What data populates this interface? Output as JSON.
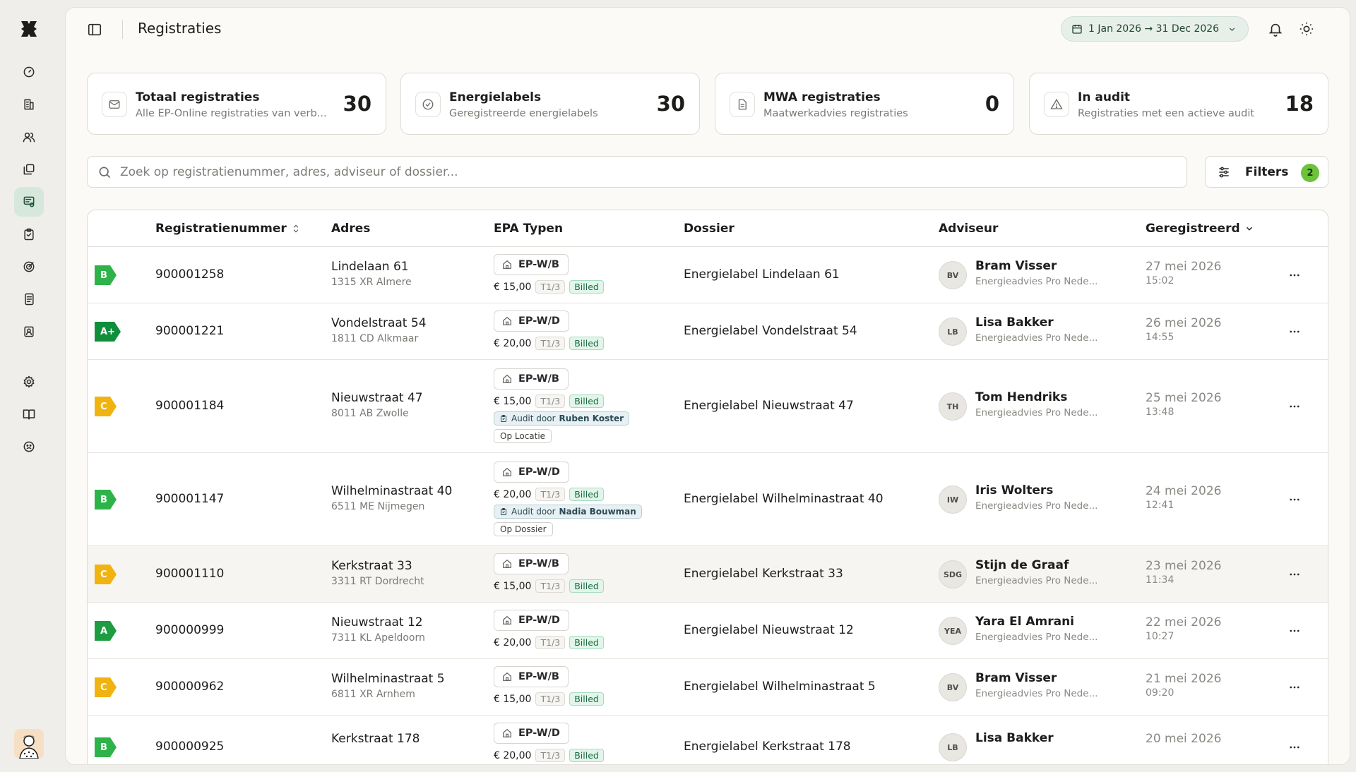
{
  "app": {
    "page_title": "Registraties"
  },
  "header": {
    "date_range": "1 Jan 2026 → 31 Dec 2026"
  },
  "nav": [
    "dashboard-icon",
    "buildings-icon",
    "users-icon",
    "files-icon",
    "registrations-icon",
    "clipboard-icon",
    "target-icon",
    "notebook-icon",
    "contacts-icon",
    "settings-icon",
    "book-icon",
    "smiley-icon"
  ],
  "cards": [
    {
      "title": "Totaal registraties",
      "subtitle": "Alle EP-Online registraties van verb...",
      "value": "30",
      "icon": "mail-icon"
    },
    {
      "title": "Energielabels",
      "subtitle": "Geregistreerde energielabels",
      "value": "30",
      "icon": "check-circle-icon"
    },
    {
      "title": "MWA registraties",
      "subtitle": "Maatwerkadvies registraties",
      "value": "0",
      "icon": "document-icon"
    },
    {
      "title": "In audit",
      "subtitle": "Registraties met een actieve audit",
      "value": "18",
      "icon": "warning-icon"
    }
  ],
  "search": {
    "placeholder": "Zoek op registratienummer, adres, adviseur of dossier..."
  },
  "filters": {
    "label": "Filters",
    "count": "2"
  },
  "table": {
    "columns": {
      "registratienummer": "Registratienummer",
      "adres": "Adres",
      "epa": "EPA Typen",
      "dossier": "Dossier",
      "adviseur": "Adviseur",
      "geregistreerd": "Geregistreerd"
    },
    "rows": [
      {
        "label": "B",
        "label_color": "#2db34a",
        "nummer": "900001258",
        "straat": "Lindelaan 61",
        "plaats": "1315 XR Almere",
        "epa": "EP-W/B",
        "prijs": "€ 15,00",
        "tcode": "T1/3",
        "status": "Billed",
        "dossier": "Energielabel Lindelaan 61",
        "initials": "BV",
        "adviseur": "Bram Visser",
        "org": "Energieadvies Pro Nede...",
        "datum": "27 mei 2026",
        "tijd": "15:02"
      },
      {
        "label": "A+",
        "label_color": "#0f8f3b",
        "nummer": "900001221",
        "straat": "Vondelstraat 54",
        "plaats": "1811 CD Alkmaar",
        "epa": "EP-W/D",
        "prijs": "€ 20,00",
        "tcode": "T1/3",
        "status": "Billed",
        "dossier": "Energielabel Vondelstraat 54",
        "initials": "LB",
        "adviseur": "Lisa Bakker",
        "org": "Energieadvies Pro Nede...",
        "datum": "26 mei 2026",
        "tijd": "14:55"
      },
      {
        "label": "C",
        "label_color": "#f1b30f",
        "nummer": "900001184",
        "straat": "Nieuwstraat 47",
        "plaats": "8011 AB Zwolle",
        "epa": "EP-W/B",
        "prijs": "€ 15,00",
        "tcode": "T1/3",
        "status": "Billed",
        "audit_prefix": "Audit door",
        "audit_name": "Ruben Koster",
        "audit_type": "Op Locatie",
        "dossier": "Energielabel Nieuwstraat 47",
        "initials": "TH",
        "adviseur": "Tom Hendriks",
        "org": "Energieadvies Pro Nede...",
        "datum": "25 mei 2026",
        "tijd": "13:48"
      },
      {
        "label": "B",
        "label_color": "#2db34a",
        "nummer": "900001147",
        "straat": "Wilhelminastraat 40",
        "plaats": "6511 ME Nijmegen",
        "epa": "EP-W/D",
        "prijs": "€ 20,00",
        "tcode": "T1/3",
        "status": "Billed",
        "audit_prefix": "Audit door",
        "audit_name": "Nadia Bouwman",
        "audit_type": "Op Dossier",
        "dossier": "Energielabel Wilhelminastraat 40",
        "initials": "IW",
        "adviseur": "Iris Wolters",
        "org": "Energieadvies Pro Nede...",
        "datum": "24 mei 2026",
        "tijd": "12:41"
      },
      {
        "label": "C",
        "label_color": "#f1b30f",
        "nummer": "900001110",
        "straat": "Kerkstraat 33",
        "plaats": "3311 RT Dordrecht",
        "epa": "EP-W/B",
        "prijs": "€ 15,00",
        "tcode": "T1/3",
        "status": "Billed",
        "dossier": "Energielabel Kerkstraat 33",
        "initials": "SDG",
        "adviseur": "Stijn de Graaf",
        "org": "Energieadvies Pro Nede...",
        "datum": "23 mei 2026",
        "tijd": "11:34"
      },
      {
        "label": "A",
        "label_color": "#1d9c42",
        "nummer": "900000999",
        "straat": "Nieuwstraat 12",
        "plaats": "7311 KL Apeldoorn",
        "epa": "EP-W/D",
        "prijs": "€ 20,00",
        "tcode": "T1/3",
        "status": "Billed",
        "dossier": "Energielabel Nieuwstraat 12",
        "initials": "YEA",
        "adviseur": "Yara El Amrani",
        "org": "Energieadvies Pro Nede...",
        "datum": "22 mei 2026",
        "tijd": "10:27"
      },
      {
        "label": "C",
        "label_color": "#f1b30f",
        "nummer": "900000962",
        "straat": "Wilhelminastraat 5",
        "plaats": "6811 XR Arnhem",
        "epa": "EP-W/B",
        "prijs": "€ 15,00",
        "tcode": "T1/3",
        "status": "Billed",
        "dossier": "Energielabel Wilhelminastraat 5",
        "initials": "BV",
        "adviseur": "Bram Visser",
        "org": "Energieadvies Pro Nede...",
        "datum": "21 mei 2026",
        "tijd": "09:20"
      },
      {
        "label": "B",
        "label_color": "#2db34a",
        "nummer": "900000925",
        "straat": "Kerkstraat 178",
        "plaats": "",
        "epa": "EP-W/D",
        "prijs": "€ 20,00",
        "tcode": "T1/3",
        "status": "Billed",
        "dossier": "Energielabel Kerkstraat 178",
        "initials": "LB",
        "adviseur": "Lisa Bakker",
        "org": "",
        "datum": "20 mei 2026",
        "tijd": ""
      }
    ]
  }
}
